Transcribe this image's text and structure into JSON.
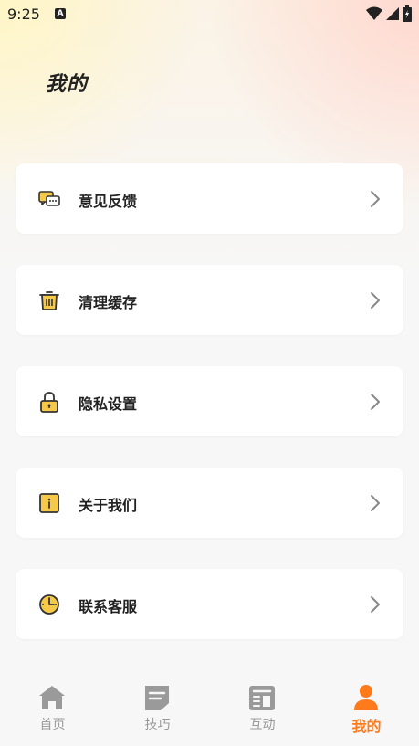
{
  "status_bar": {
    "time": "9:25",
    "badge": "A"
  },
  "page": {
    "title": "我的"
  },
  "menu": [
    {
      "label": "意见反馈",
      "icon": "feedback-chat-icon"
    },
    {
      "label": "清理缓存",
      "icon": "trash-bin-icon"
    },
    {
      "label": "隐私设置",
      "icon": "lock-icon"
    },
    {
      "label": "关于我们",
      "icon": "info-icon"
    },
    {
      "label": "联系客服",
      "icon": "clock-icon"
    }
  ],
  "tabs": [
    {
      "label": "首页",
      "icon": "home-icon",
      "active": false
    },
    {
      "label": "技巧",
      "icon": "notes-icon",
      "active": false
    },
    {
      "label": "互动",
      "icon": "news-icon",
      "active": false
    },
    {
      "label": "我的",
      "icon": "person-icon",
      "active": true
    }
  ],
  "colors": {
    "accent": "#ff7a1a",
    "icon_yellow": "#f6c948",
    "inactive": "#9a9a9a"
  }
}
